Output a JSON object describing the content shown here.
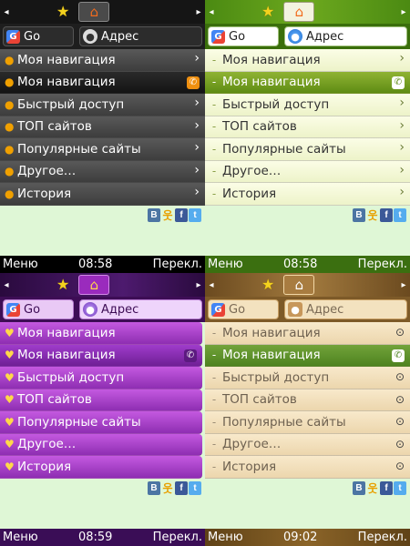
{
  "icons": {
    "star": "★",
    "home": "⌂",
    "arrow_left": "◂",
    "arrow_right": "▸",
    "chevron": "›",
    "circle_chevron": "⊙",
    "phone": "✆",
    "g_logo": "G",
    "globe": "●"
  },
  "colors": {
    "background": "#dff7d6",
    "accent_orange": "#f09010",
    "green_selected": "#5f8c14",
    "purple_row": "#c459e0",
    "beige_row": "#f8e9cb"
  },
  "panels": [
    {
      "theme": "dark",
      "search": {
        "go": "Go",
        "address": "Адрес"
      },
      "menu": [
        "Моя навигация",
        "Моя навигация",
        "Быстрый доступ",
        "ТОП сайтов",
        "Популярные сайты",
        "Другое…",
        "История"
      ],
      "softkeys": {
        "left": "Меню",
        "time": "08:58",
        "right": "Перекл."
      }
    },
    {
      "theme": "green",
      "search": {
        "go": "Go",
        "address": "Адрес"
      },
      "menu": [
        "Моя навигация",
        "Моя навигация",
        "Быстрый доступ",
        "ТОП сайтов",
        "Популярные сайты",
        "Другое…",
        "История"
      ],
      "softkeys": {
        "left": "Меню",
        "time": "08:58",
        "right": "Перекл."
      }
    },
    {
      "theme": "purple",
      "search": {
        "go": "Go",
        "address": "Адрес"
      },
      "menu": [
        "Моя навигация",
        "Моя навигация",
        "Быстрый доступ",
        "ТОП сайтов",
        "Популярные сайты",
        "Другое…",
        "История"
      ],
      "softkeys": {
        "left": "Меню",
        "time": "08:59",
        "right": "Перекл."
      }
    },
    {
      "theme": "beige",
      "search": {
        "go": "Go",
        "address": "Адрес"
      },
      "menu": [
        "Моя навигация",
        "Моя навигация",
        "Быстрый доступ",
        "ТОП сайтов",
        "Популярные сайты",
        "Другое…",
        "История"
      ],
      "softkeys": {
        "left": "Меню",
        "time": "09:02",
        "right": "Перекл."
      }
    }
  ],
  "social": {
    "vk": "B",
    "people": "웃",
    "facebook": "f",
    "twitter": "t"
  }
}
